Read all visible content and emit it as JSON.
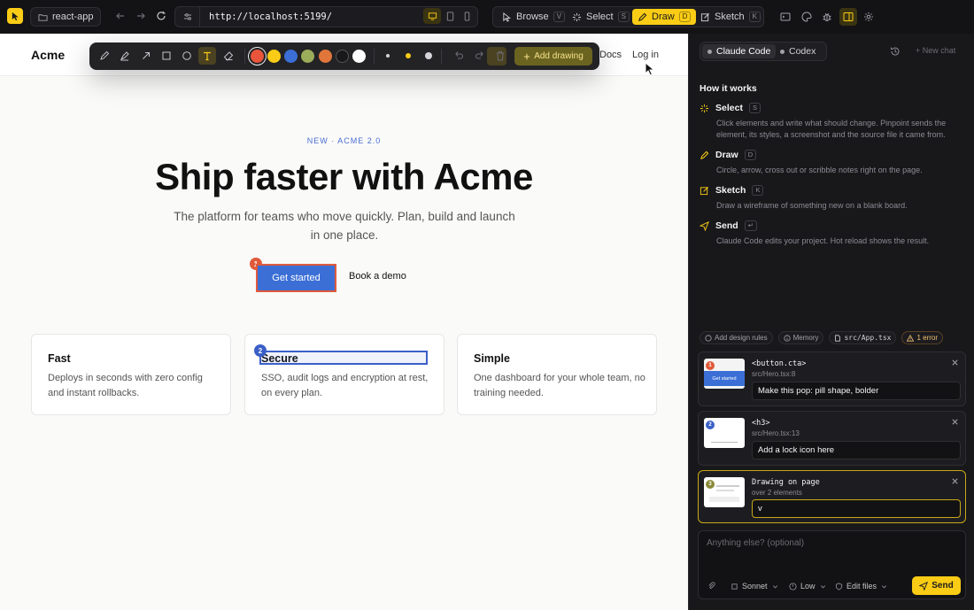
{
  "topbar": {
    "project": "react-app",
    "url": "http://localhost:5199/",
    "modes": [
      {
        "label": "Browse",
        "key": "V",
        "icon": "cursor-icon"
      },
      {
        "label": "Select",
        "key": "S",
        "icon": "sparkle-icon"
      },
      {
        "label": "Draw",
        "key": "D",
        "icon": "pen-icon"
      },
      {
        "label": "Sketch",
        "key": "K",
        "icon": "sketch-icon"
      }
    ],
    "active_mode": "Draw",
    "accent": "#facc15"
  },
  "site": {
    "brand": "Acme",
    "nav": [
      "Docs",
      "Log in"
    ],
    "tag": "NEW · ACME 2.0",
    "title": "Ship faster with Acme",
    "subtitle": "The platform for teams who move quickly. Plan, build and launch in one place.",
    "primary_cta": "Get started",
    "secondary_cta": "Book a demo",
    "cards": [
      {
        "title": "Fast",
        "body": "Deploys in seconds with zero config and instant rollbacks."
      },
      {
        "title": "Secure",
        "body": "SSO, audit logs and encryption at rest, on every plan."
      },
      {
        "title": "Simple",
        "body": "One dashboard for your whole team, no training needed."
      }
    ],
    "markers": [
      "1",
      "2"
    ]
  },
  "draw_toolbar": {
    "colors": [
      "#e8553a",
      "#facc15",
      "#3b6fd6",
      "#9bac5a",
      "#e0763a",
      "#18181b",
      "#ffffff"
    ],
    "selected_color": "#e8553a",
    "add_button": "Add drawing"
  },
  "panel": {
    "tabs": [
      "Claude Code",
      "Codex"
    ],
    "active_tab": "Claude Code",
    "new_chat": "New chat",
    "how_title": "How it works",
    "how": [
      {
        "label": "Select",
        "key": "S",
        "desc": "Click elements and write what should change. Pinpoint sends the element, its styles, a screenshot and the source file it came from."
      },
      {
        "label": "Draw",
        "key": "D",
        "desc": "Circle, arrow, cross out or scribble notes right on the page."
      },
      {
        "label": "Sketch",
        "key": "K",
        "desc": "Draw a wireframe of something new on a blank board."
      },
      {
        "label": "Send",
        "key": "↵",
        "desc": "Claude Code edits your project. Hot reload shows the result."
      }
    ],
    "chips": [
      "Add design rules",
      "Memory",
      "src/App.tsx",
      "1 error"
    ],
    "annotations": [
      {
        "num": "1",
        "tag": "<button.cta>",
        "file": "src/Hero.tsx:8",
        "note": "Make this pop: pill shape, bolder",
        "thumb_text": "Get started"
      },
      {
        "num": "2",
        "tag": "<h3>",
        "file": "src/Hero.tsx:13",
        "note": "Add a lock icon here"
      },
      {
        "num": "3",
        "tag": "Drawing on page",
        "file": "over 2 elements",
        "note": "v"
      }
    ],
    "composer": {
      "placeholder": "Anything else? (optional)",
      "model": "Sonnet",
      "effort": "Low",
      "permission": "Edit files",
      "send": "Send"
    }
  }
}
